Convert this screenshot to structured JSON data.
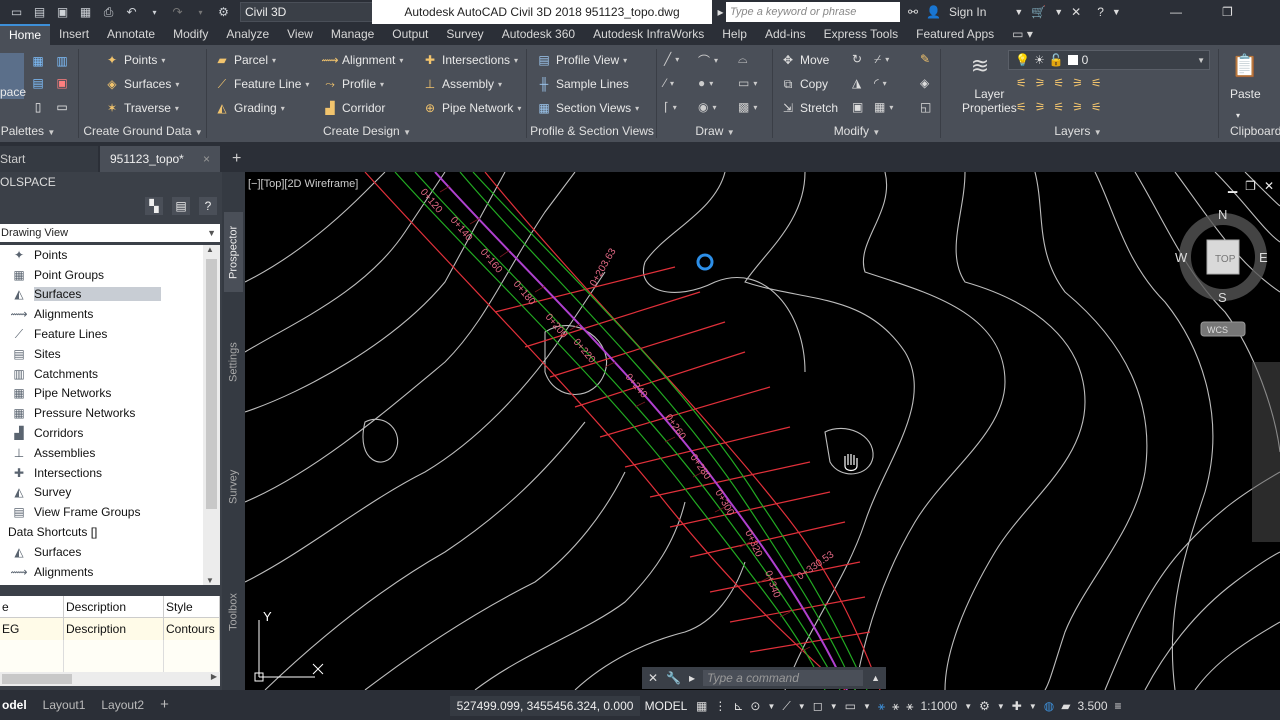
{
  "qat": {
    "workspace": "Civil 3D"
  },
  "titlebar": {
    "app_title": "Autodesk AutoCAD Civil 3D 2018    951123_topo.dwg",
    "search_placeholder": "Type a keyword or phrase",
    "sign_in": "Sign In"
  },
  "ribbon_tabs": [
    "Home",
    "Insert",
    "Annotate",
    "Modify",
    "Analyze",
    "View",
    "Manage",
    "Output",
    "Survey",
    "Autodesk 360",
    "Autodesk InfraWorks",
    "Help",
    "Add-ins",
    "Express Tools",
    "Featured Apps"
  ],
  "ribbon": {
    "toolspace_btn": "space",
    "palettes_title": "Palettes",
    "ground": {
      "points": "Points",
      "surfaces": "Surfaces",
      "traverse": "Traverse",
      "title": "Create Ground Data"
    },
    "design": {
      "parcel": "Parcel",
      "feature_line": "Feature Line",
      "grading": "Grading",
      "alignment": "Alignment",
      "profile": "Profile",
      "corridor": "Corridor",
      "intersections": "Intersections",
      "assembly": "Assembly",
      "pipe_network": "Pipe Network",
      "title": "Create Design"
    },
    "views": {
      "profile_view": "Profile View",
      "sample_lines": "Sample Lines",
      "section_views": "Section Views",
      "title": "Profile & Section Views"
    },
    "draw": {
      "title": "Draw"
    },
    "modify": {
      "move": "Move",
      "copy": "Copy",
      "stretch": "Stretch",
      "title": "Modify"
    },
    "layers": {
      "current": "0",
      "layer_properties_1": "Layer",
      "layer_properties_2": "Properties",
      "title": "Layers"
    },
    "clipboard": {
      "paste": "Paste",
      "title": "Clipboard"
    }
  },
  "doc_tabs": [
    {
      "label": "Start"
    },
    {
      "label": "951123_topo*",
      "close": "×"
    }
  ],
  "toolspace": {
    "title": "OLSPACE",
    "view": "Drawing View",
    "tree": [
      "Points",
      "Point Groups",
      "Surfaces",
      "Alignments",
      "Feature Lines",
      "Sites",
      "Catchments",
      "Pipe Networks",
      "Pressure Networks",
      "Corridors",
      "Assemblies",
      "Intersections",
      "Survey",
      "View Frame Groups",
      "Data Shortcuts []",
      "Surfaces",
      "Alignments"
    ],
    "side_tabs": [
      "Prospector",
      "Settings",
      "Survey",
      "Toolbox"
    ],
    "grid": {
      "headers": [
        "e",
        "Description",
        "Style"
      ],
      "row": [
        "EG",
        "Description",
        "Contours"
      ]
    }
  },
  "viewport": {
    "label": "[−][Top][2D Wireframe]",
    "compass": {
      "n": "N",
      "s": "S",
      "e": "E",
      "w": "W",
      "top": "TOP",
      "wcs": "WCS"
    },
    "ucs_y": "Y",
    "ucs_x": "X"
  },
  "stations": [
    "0+120",
    "0+140",
    "0+160",
    "0+180",
    "0+200",
    "0+203.63",
    "0+220",
    "0+240",
    "0+260",
    "0+280",
    "0+300",
    "0+320",
    "0+330.53",
    "0+340"
  ],
  "command": {
    "placeholder": "Type  a  command"
  },
  "status": {
    "tabs": [
      "odel",
      "Layout1",
      "Layout2"
    ],
    "coords": "527499.099, 3455456.324, 0.000",
    "model": "MODEL",
    "scale": "1:1000",
    "value": "3.500"
  },
  "colors": {
    "background": "#000000",
    "contour": "#bdbdbd",
    "corridor_frame": "#e0303a",
    "corridor_line": "#22aa22",
    "alignment": "#b040d0",
    "accent": "#3d8fd8"
  }
}
